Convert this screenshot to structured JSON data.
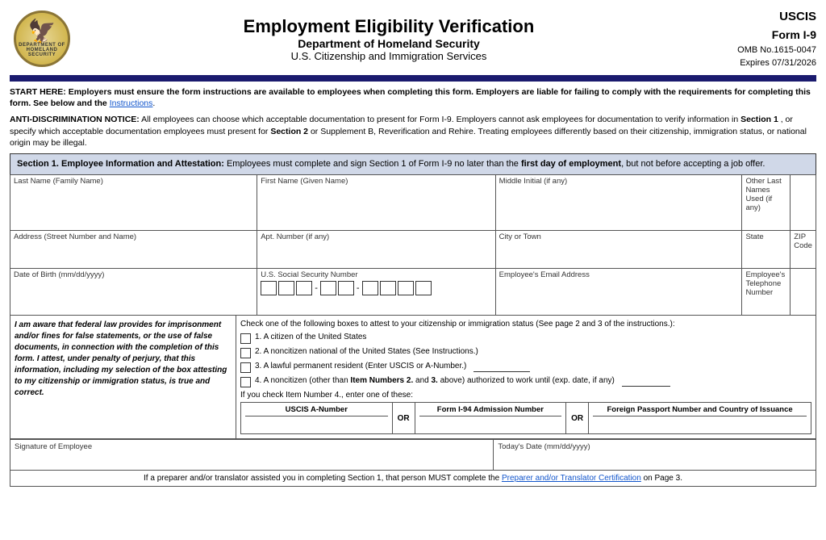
{
  "header": {
    "title": "Employment Eligibility Verification",
    "subtitle": "Department of Homeland Security",
    "subtitle2": "U.S. Citizenship and Immigration Services",
    "form_id": "USCIS",
    "form_name": "Form I-9",
    "omb": "OMB No.1615-0047",
    "expires": "Expires 07/31/2026"
  },
  "notices": {
    "start_here": "START HERE:  Employers must ensure the form instructions are available to employees when completing this form.  Employers are liable for failing to comply with the requirements for completing this form.  See below and the",
    "start_here_link": "Instructions",
    "anti_disc_label": "ANTI-DISCRIMINATION NOTICE:",
    "anti_disc_text": " All employees can choose which acceptable documentation to present for Form I-9.  Employers cannot ask employees for documentation to verify information in ",
    "section1_ref": "Section 1",
    "anti_disc_mid": ", or specify which acceptable documentation employees must present for ",
    "section2_ref": "Section 2",
    "anti_disc_end": " or Supplement B, Reverification and Rehire.  Treating employees differently based on their citizenship, immigration status, or national origin may be illegal."
  },
  "section1": {
    "header": "Section 1. Employee Information and Attestation:",
    "header_body": " Employees must complete and sign Section 1 of Form I-9 no later than the ",
    "bold1": "first day of employment",
    "header_end": ", but not before accepting a job offer.",
    "fields": {
      "last_name": "Last Name (Family Name)",
      "first_name": "First Name (Given Name)",
      "middle_initial": "Middle Initial (if any)",
      "other_last_names": "Other Last Names Used (if any)",
      "address": "Address (Street Number and Name)",
      "apt_number": "Apt. Number (if any)",
      "city_or_town": "City or Town",
      "state": "State",
      "zip_code": "ZIP Code",
      "dob": "Date of Birth (mm/dd/yyyy)",
      "ssn": "U.S. Social Security Number",
      "email": "Employee's Email Address",
      "phone": "Employee's Telephone Number"
    },
    "attestation": {
      "left_text": "I am aware that federal law provides for imprisonment and/or fines for false statements, or the use of false documents, in connection with the completion of this form.  I attest, under penalty of perjury, that this information, including my selection of the box attesting to my citizenship or immigration status, is true and correct.",
      "right_intro": "Check one of the following boxes to attest to your citizenship or immigration status (See page 2 and 3 of the instructions.):",
      "options": [
        "1.  A citizen of the United States",
        "2.  A noncitizen national of the United States (See Instructions.)",
        "3.  A lawful permanent resident (Enter USCIS or A-Number.)",
        "4.  A noncitizen (other than Item Numbers 2. and 3. above) authorized to work until (exp. date, if any)"
      ],
      "item4_label": "If you check Item Number 4., enter one of these:",
      "uscis_a": "USCIS A-Number",
      "form_i94": "Form I-94 Admission Number",
      "foreign_passport": "Foreign Passport Number and Country of Issuance",
      "or": "OR"
    },
    "signature_label": "Signature of Employee",
    "todays_date_label": "Today's Date (mm/dd/yyyy)"
  },
  "footer": {
    "text": "If a preparer and/or translator assisted you in completing Section 1, that person MUST complete the ",
    "link": "Preparer and/or Translator Certification",
    "text_end": " on Page 3."
  }
}
